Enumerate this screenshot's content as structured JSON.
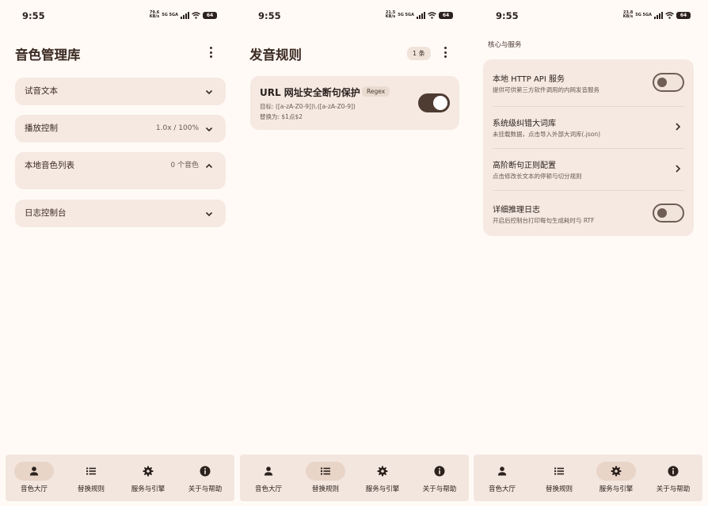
{
  "status_bar": {
    "time": "9:55",
    "screens": [
      {
        "speed": "79.6 KB/s",
        "network": "5G 5GA",
        "battery": "64"
      },
      {
        "speed": "21.5 KB/s",
        "network": "5G 5GA",
        "battery": "64"
      },
      {
        "speed": "23.8 KB/s",
        "network": "5G 5GA",
        "battery": "64"
      }
    ]
  },
  "screen1": {
    "title": "音色管理库",
    "sections": [
      {
        "label": "试音文本",
        "value": "",
        "expanded": false
      },
      {
        "label": "播放控制",
        "value": "1.0x / 100%",
        "expanded": false
      },
      {
        "label": "本地音色列表",
        "value": "0 个音色",
        "expanded": true
      },
      {
        "label": "日志控制台",
        "value": "",
        "expanded": false
      }
    ]
  },
  "screen2": {
    "title": "发音规则",
    "count_badge": "1 条",
    "rules": [
      {
        "title": "URL 网址安全断句保护",
        "badge": "Regex",
        "target": "目标: ([a-zA-Z0-9])\\.([a-zA-Z0-9])",
        "replace": "替换为: $1点$2",
        "enabled": true
      }
    ]
  },
  "screen3": {
    "section_label": "核心与服务",
    "items": [
      {
        "title": "本地 HTTP API 服务",
        "subtitle": "提供可供第三方软件调用的内网发音服务",
        "control": "toggle",
        "enabled": false
      },
      {
        "title": "系统级纠错大词库",
        "subtitle": "未挂载数据，点击导入外部大词库(.json)",
        "control": "arrow"
      },
      {
        "title": "高阶断句正则配置",
        "subtitle": "点击修改长文本的停顿与切分规则",
        "control": "arrow"
      },
      {
        "title": "详细推理日志",
        "subtitle": "开启后控制台打印每句生成耗时与 RTF",
        "control": "toggle",
        "enabled": false
      }
    ]
  },
  "nav": {
    "items": [
      {
        "label": "音色大厅",
        "icon": "person-icon"
      },
      {
        "label": "替换规则",
        "icon": "list-icon"
      },
      {
        "label": "服务与引擎",
        "icon": "gear-icon"
      },
      {
        "label": "关于与帮助",
        "icon": "info-icon"
      }
    ],
    "active": [
      "音色大厅",
      "替换规则",
      "服务与引擎"
    ]
  },
  "colors": {
    "background": "#fffaf6",
    "card": "#f5e9e1",
    "accent": "#4e3b31",
    "nav_active": "#e9d4c8"
  }
}
